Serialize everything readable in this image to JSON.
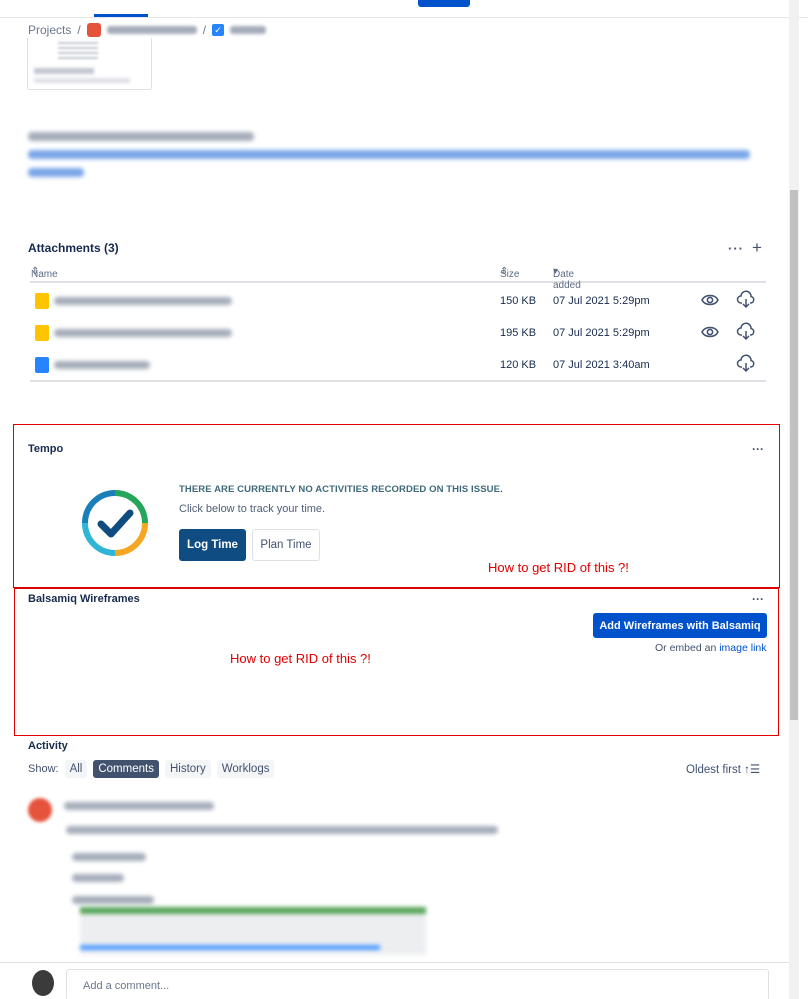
{
  "breadcrumb": {
    "projects": "Projects",
    "separator": "/"
  },
  "attachments": {
    "title": "Attachments (3)",
    "more_label": "···",
    "add_label": "+",
    "columns": {
      "name": "Name",
      "size": "Size",
      "date": "Date added"
    },
    "rows": [
      {
        "size": "150 KB",
        "date": "07 Jul 2021 5:29pm",
        "type": "image"
      },
      {
        "size": "195 KB",
        "date": "07 Jul 2021 5:29pm",
        "type": "image"
      },
      {
        "size": "120 KB",
        "date": "07 Jul 2021 3:40am",
        "type": "document"
      }
    ]
  },
  "tempo": {
    "title": "Tempo",
    "more_label": "···",
    "heading": "THERE ARE CURRENTLY NO ACTIVITIES RECORDED ON THIS ISSUE.",
    "subtitle": "Click below to track your time.",
    "log_time": "Log Time",
    "plan_time": "Plan Time",
    "annotation": "How to get RID of this ?!"
  },
  "balsamiq": {
    "title": "Balsamiq Wireframes",
    "more_label": "···",
    "add_button": "Add Wireframes with Balsamiq",
    "embed_prefix": "Or embed an",
    "embed_link": "image link",
    "annotation": "How to get RID of this ?!"
  },
  "activity": {
    "title": "Activity",
    "show_label": "Show:",
    "filters": [
      "All",
      "Comments",
      "History",
      "Worklogs"
    ],
    "active_filter": "Comments",
    "sort_label": "Oldest first"
  },
  "comment_box": {
    "placeholder": "Add a comment..."
  },
  "colors": {
    "primary": "#0052cc",
    "tempo_button": "#0f4c81",
    "annotation_red": "#e00000"
  }
}
